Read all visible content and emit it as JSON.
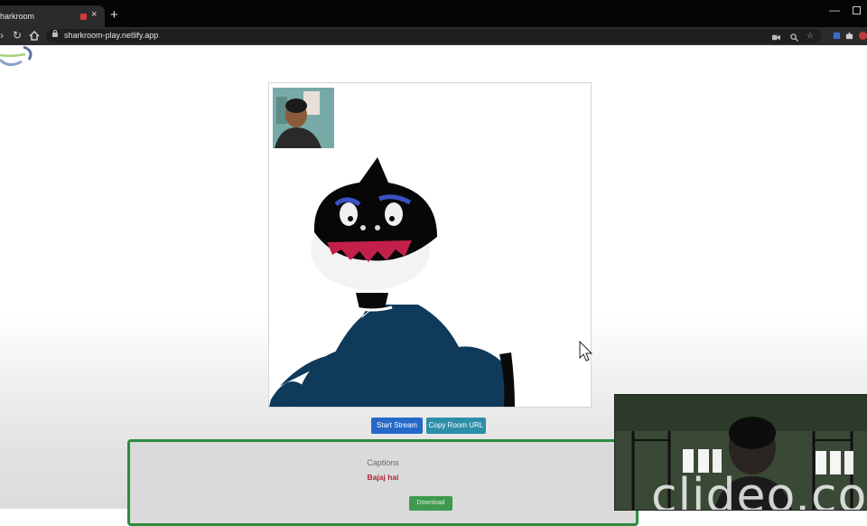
{
  "browser": {
    "tab_title": "harkroom",
    "tab_close": "×",
    "new_tab": "+",
    "address": "sharkroom-play.netlify.app"
  },
  "stage": {
    "buttons": {
      "start_stream": "Start Stream",
      "copy_room_url": "Copy Room URL"
    }
  },
  "captions": {
    "title": "Captions",
    "text": "Bajaj hai",
    "download": "Download"
  },
  "webcam_overlay": {
    "watermark": "clideo.com"
  },
  "colors": {
    "primary_button": "#2469c9",
    "info_button": "#2d8eaa",
    "success_button": "#3d9a4f",
    "captions_border": "#2e8b3f",
    "caption_text": "#b0273a",
    "avatar_body": "#0f3a5a"
  }
}
